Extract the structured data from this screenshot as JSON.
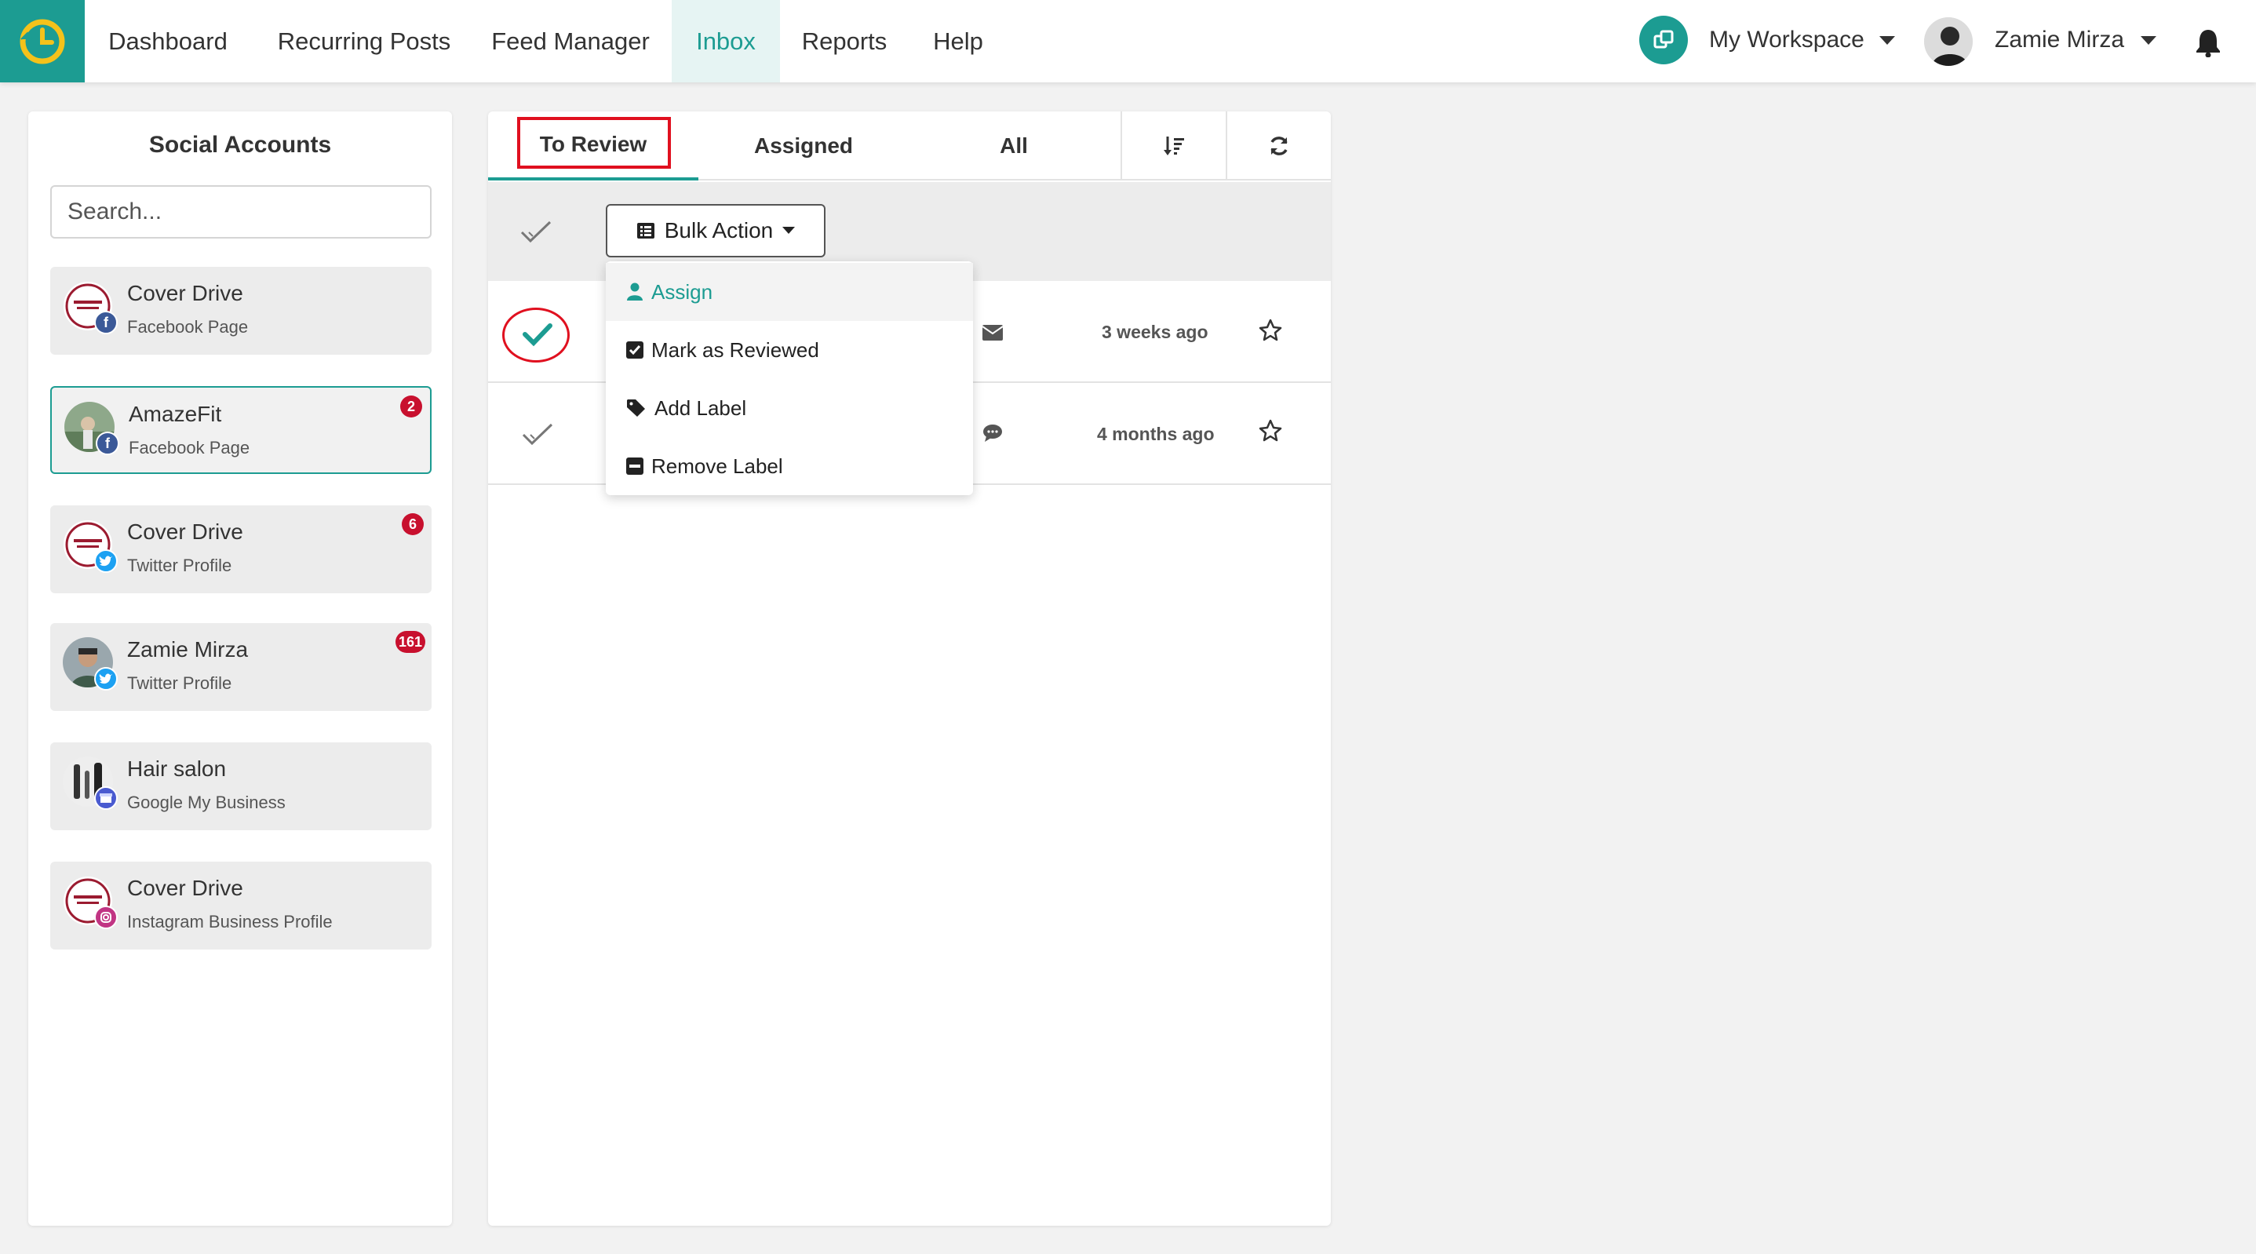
{
  "nav": {
    "items": [
      {
        "label": "Dashboard"
      },
      {
        "label": "Recurring Posts"
      },
      {
        "label": "Feed Manager"
      },
      {
        "label": "Inbox",
        "active": true
      },
      {
        "label": "Reports"
      },
      {
        "label": "Help"
      }
    ],
    "workspace": "My Workspace",
    "user": "Zamie Mirza"
  },
  "sidebar": {
    "title": "Social Accounts",
    "search_placeholder": "Search...",
    "accounts": [
      {
        "name": "Cover Drive",
        "type": "Facebook Page",
        "network": "facebook",
        "badge": ""
      },
      {
        "name": "AmazeFit",
        "type": "Facebook Page",
        "network": "facebook",
        "badge": "2",
        "selected": true
      },
      {
        "name": "Cover Drive",
        "type": "Twitter Profile",
        "network": "twitter",
        "badge": "6"
      },
      {
        "name": "Zamie Mirza",
        "type": "Twitter Profile",
        "network": "twitter",
        "badge": "161"
      },
      {
        "name": "Hair salon",
        "type": "Google My Business",
        "network": "google",
        "badge": ""
      },
      {
        "name": "Cover Drive",
        "type": "Instagram Business Profile",
        "network": "instagram",
        "badge": ""
      }
    ]
  },
  "inbox": {
    "tabs": [
      {
        "label": "To Review",
        "active": true
      },
      {
        "label": "Assigned"
      },
      {
        "label": "All"
      }
    ],
    "bulk_action_label": "Bulk Action",
    "bulk_menu": [
      {
        "label": "Assign",
        "icon": "user-icon"
      },
      {
        "label": "Mark as Reviewed",
        "icon": "checkbox-icon"
      },
      {
        "label": "Add Label",
        "icon": "tag-icon"
      },
      {
        "label": "Remove Label",
        "icon": "minus-square-icon"
      }
    ],
    "rows": [
      {
        "time": "3 weeks ago",
        "kind": "envelope-icon",
        "checked": true
      },
      {
        "time": "4 months ago",
        "kind": "comment-icon",
        "checked": false
      }
    ]
  },
  "colors": {
    "accent": "#1c9c92",
    "highlight": "#e0101f",
    "badge": "#c8102e",
    "facebook": "#3b5998",
    "twitter": "#1da1f2",
    "google": "#4a5bd0",
    "instagram": "#c13584"
  }
}
